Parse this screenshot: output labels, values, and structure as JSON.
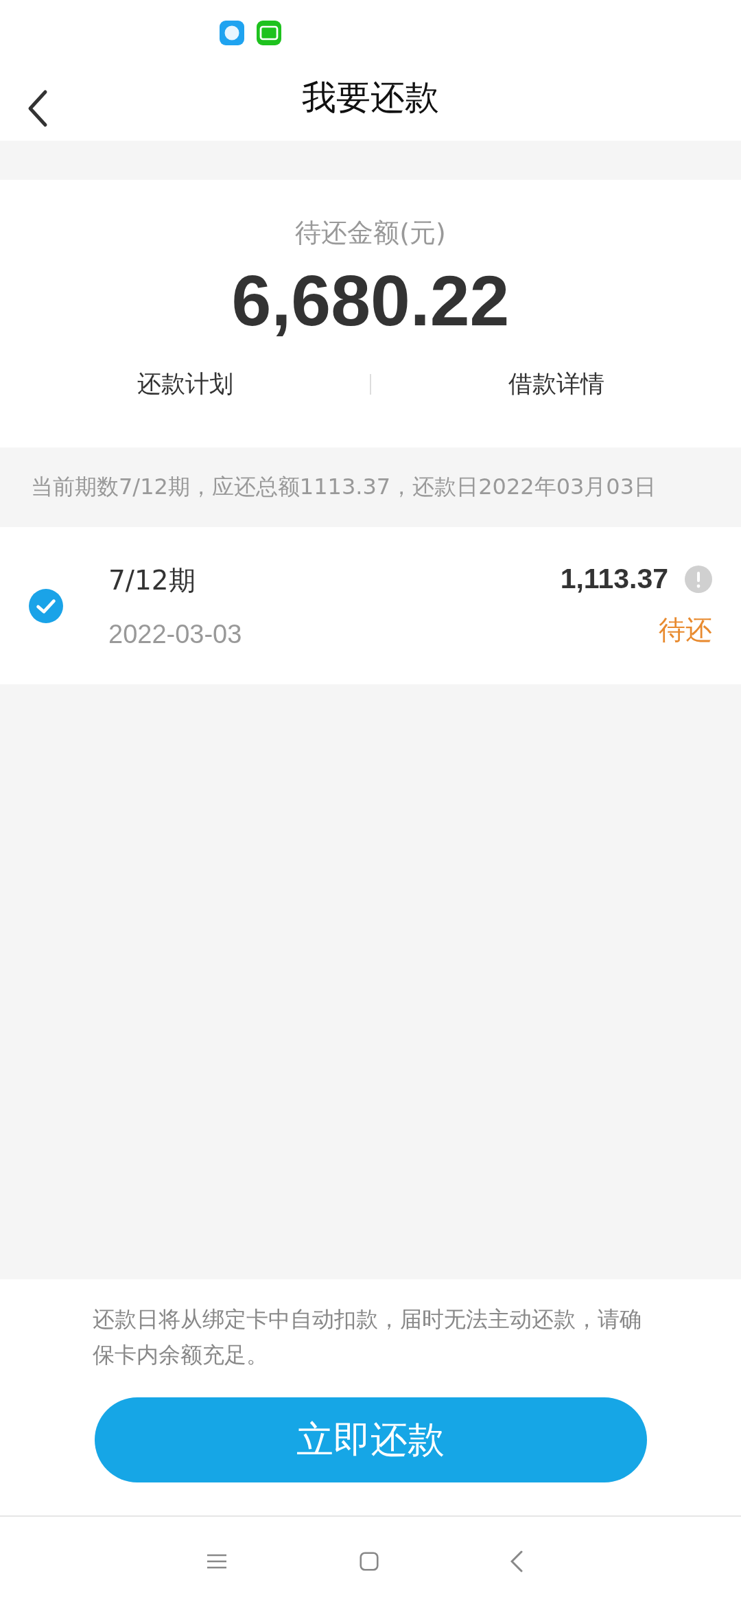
{
  "header": {
    "title": "我要还款"
  },
  "summary": {
    "label": "待还金额(元)",
    "amount": "6,680.22",
    "links": [
      "还款计划",
      "借款详情"
    ]
  },
  "info": "当前期数7/12期，应还总额1113.37，还款日2022年03月03日",
  "installments": [
    {
      "period": "7/12期",
      "date": "2022-03-03",
      "amount": "1,113.37",
      "status": "待还",
      "checked": true
    }
  ],
  "notice": "还款日将从绑定卡中自动扣款，届时无法主动还款，请确保卡内余额充足。",
  "pay_button": "立即还款"
}
